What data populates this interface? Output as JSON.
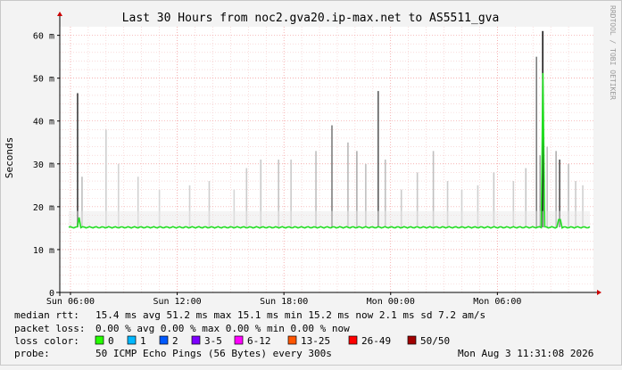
{
  "chart_data": {
    "type": "line",
    "title": "Last 30 Hours from noc2.gva20.ip-max.net to AS5511_gva",
    "ylabel": "Seconds",
    "xlabel": "",
    "ylim": [
      0,
      0.062
    ],
    "y_ticks": [
      {
        "v": 0,
        "label": "0"
      },
      {
        "v": 0.01,
        "label": "10 m"
      },
      {
        "v": 0.02,
        "label": "20 m"
      },
      {
        "v": 0.03,
        "label": "30 m"
      },
      {
        "v": 0.04,
        "label": "40 m"
      },
      {
        "v": 0.05,
        "label": "50 m"
      },
      {
        "v": 0.06,
        "label": "60 m"
      }
    ],
    "x_range_hours": [
      0,
      30
    ],
    "x_ticks": [
      {
        "t": 0.6,
        "label": "Sun 06:00"
      },
      {
        "t": 6.6,
        "label": "Sun 12:00"
      },
      {
        "t": 12.6,
        "label": "Sun 18:00"
      },
      {
        "t": 18.6,
        "label": "Mon 00:00"
      },
      {
        "t": 24.6,
        "label": "Mon 06:00"
      }
    ],
    "series": [
      {
        "name": "median rtt",
        "color": "#22dd22",
        "median_ms": 15.2
      },
      {
        "name": "packet loss",
        "values_percent": 0
      }
    ],
    "spikes": [
      {
        "t": 1.0,
        "ms": 46.5,
        "shade": "#333333"
      },
      {
        "t": 1.25,
        "ms": 27,
        "shade": "#bbbbbb"
      },
      {
        "t": 2.6,
        "ms": 38,
        "shade": "#cccccc"
      },
      {
        "t": 3.3,
        "ms": 30,
        "shade": "#d2d2d2"
      },
      {
        "t": 4.4,
        "ms": 27,
        "shade": "#cfcfcf"
      },
      {
        "t": 5.6,
        "ms": 24,
        "shade": "#d5d5d5"
      },
      {
        "t": 7.3,
        "ms": 25,
        "shade": "#d0d0d0"
      },
      {
        "t": 8.4,
        "ms": 26,
        "shade": "#cccccc"
      },
      {
        "t": 9.8,
        "ms": 24,
        "shade": "#d4d4d4"
      },
      {
        "t": 10.5,
        "ms": 29,
        "shade": "#c8c8c8"
      },
      {
        "t": 11.3,
        "ms": 31,
        "shade": "#c6c6c6"
      },
      {
        "t": 12.3,
        "ms": 31,
        "shade": "#c0c0c0"
      },
      {
        "t": 13.0,
        "ms": 31,
        "shade": "#c8c8c8"
      },
      {
        "t": 14.4,
        "ms": 33,
        "shade": "#bbbbbb"
      },
      {
        "t": 15.3,
        "ms": 39,
        "shade": "#777777"
      },
      {
        "t": 16.2,
        "ms": 35,
        "shade": "#b5b5b5"
      },
      {
        "t": 16.7,
        "ms": 33,
        "shade": "#aaaaaa"
      },
      {
        "t": 17.2,
        "ms": 30,
        "shade": "#bdbdbd"
      },
      {
        "t": 17.9,
        "ms": 47,
        "shade": "#555555"
      },
      {
        "t": 18.3,
        "ms": 31,
        "shade": "#bbbbbb"
      },
      {
        "t": 19.2,
        "ms": 24,
        "shade": "#c8c8c8"
      },
      {
        "t": 20.1,
        "ms": 28,
        "shade": "#c4c4c4"
      },
      {
        "t": 21.0,
        "ms": 33,
        "shade": "#bcbcbc"
      },
      {
        "t": 21.8,
        "ms": 26,
        "shade": "#cacaca"
      },
      {
        "t": 22.6,
        "ms": 24,
        "shade": "#cfcfcf"
      },
      {
        "t": 23.5,
        "ms": 25,
        "shade": "#cdcdcd"
      },
      {
        "t": 24.4,
        "ms": 28,
        "shade": "#c6c6c6"
      },
      {
        "t": 25.5,
        "ms": 26,
        "shade": "#cccccc"
      },
      {
        "t": 26.2,
        "ms": 29,
        "shade": "#c2c2c2"
      },
      {
        "t": 26.8,
        "ms": 55,
        "shade": "#777777"
      },
      {
        "t": 27.0,
        "ms": 32,
        "shade": "#aaaaaa"
      },
      {
        "t": 27.15,
        "ms": 61,
        "shade": "#111111"
      },
      {
        "t": 27.4,
        "ms": 34,
        "shade": "#bbbbbb"
      },
      {
        "t": 27.9,
        "ms": 33,
        "shade": "#aaaaaa"
      },
      {
        "t": 28.1,
        "ms": 31,
        "shade": "#444444"
      },
      {
        "t": 28.6,
        "ms": 30,
        "shade": "#bbbbbb"
      },
      {
        "t": 29.0,
        "ms": 26,
        "shade": "#c8c8c8"
      },
      {
        "t": 29.4,
        "ms": 25,
        "shade": "#cdcdcd"
      }
    ],
    "median_dips": [
      {
        "t": 1.05,
        "ms": 17.5
      },
      {
        "t": 27.15,
        "ms": 51.2
      },
      {
        "t": 28.1,
        "ms": 17
      }
    ],
    "grid": true,
    "legend": "bottom"
  },
  "watermark": "RRDTOOL / TOBI OETIKER",
  "stats": {
    "rtt_label": "median rtt:",
    "rtt_values": "15.4 ms avg   51.2 ms max   15.1 ms min   15.2 ms now   2.1 ms sd   7.2   am/s",
    "loss_label": "packet loss:",
    "loss_values": "0.00 % avg   0.00 % max   0.00 % min   0.00 % now",
    "loss_color_label": "loss color:",
    "probe_label": "probe:",
    "probe_value": "50 ICMP Echo Pings (56 Bytes) every 300s",
    "timestamp": "Mon Aug  3 11:31:08 2026"
  },
  "loss_colors": [
    {
      "label": "0",
      "color": "#26ff00"
    },
    {
      "label": "1",
      "color": "#00b8ff"
    },
    {
      "label": "2",
      "color": "#0059ff"
    },
    {
      "label": "3-5",
      "color": "#7e00ff"
    },
    {
      "label": "6-12",
      "color": "#ff00ff"
    },
    {
      "label": "13-25",
      "color": "#ff5500"
    },
    {
      "label": "26-49",
      "color": "#ff0000"
    },
    {
      "label": "50/50",
      "color": "#a10000"
    }
  ]
}
